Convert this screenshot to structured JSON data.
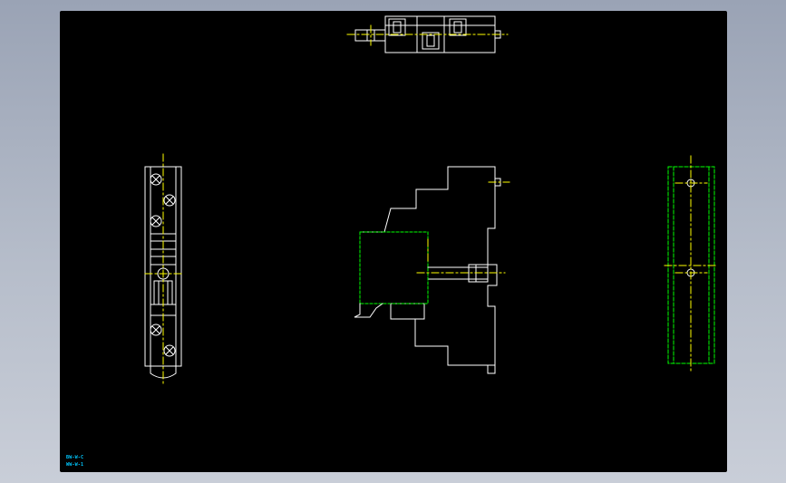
{
  "viewport": {
    "background": "#000000"
  },
  "colors": {
    "outline": "#ffffff",
    "centerline": "#ffff00",
    "hidden": "#00ff00",
    "label": "#00c8ff"
  },
  "views": [
    {
      "name": "top-view"
    },
    {
      "name": "left-view"
    },
    {
      "name": "front-view"
    },
    {
      "name": "right-view"
    }
  ],
  "annotations": {
    "line1": "BW-W-C",
    "line2": "WW-W-1"
  }
}
